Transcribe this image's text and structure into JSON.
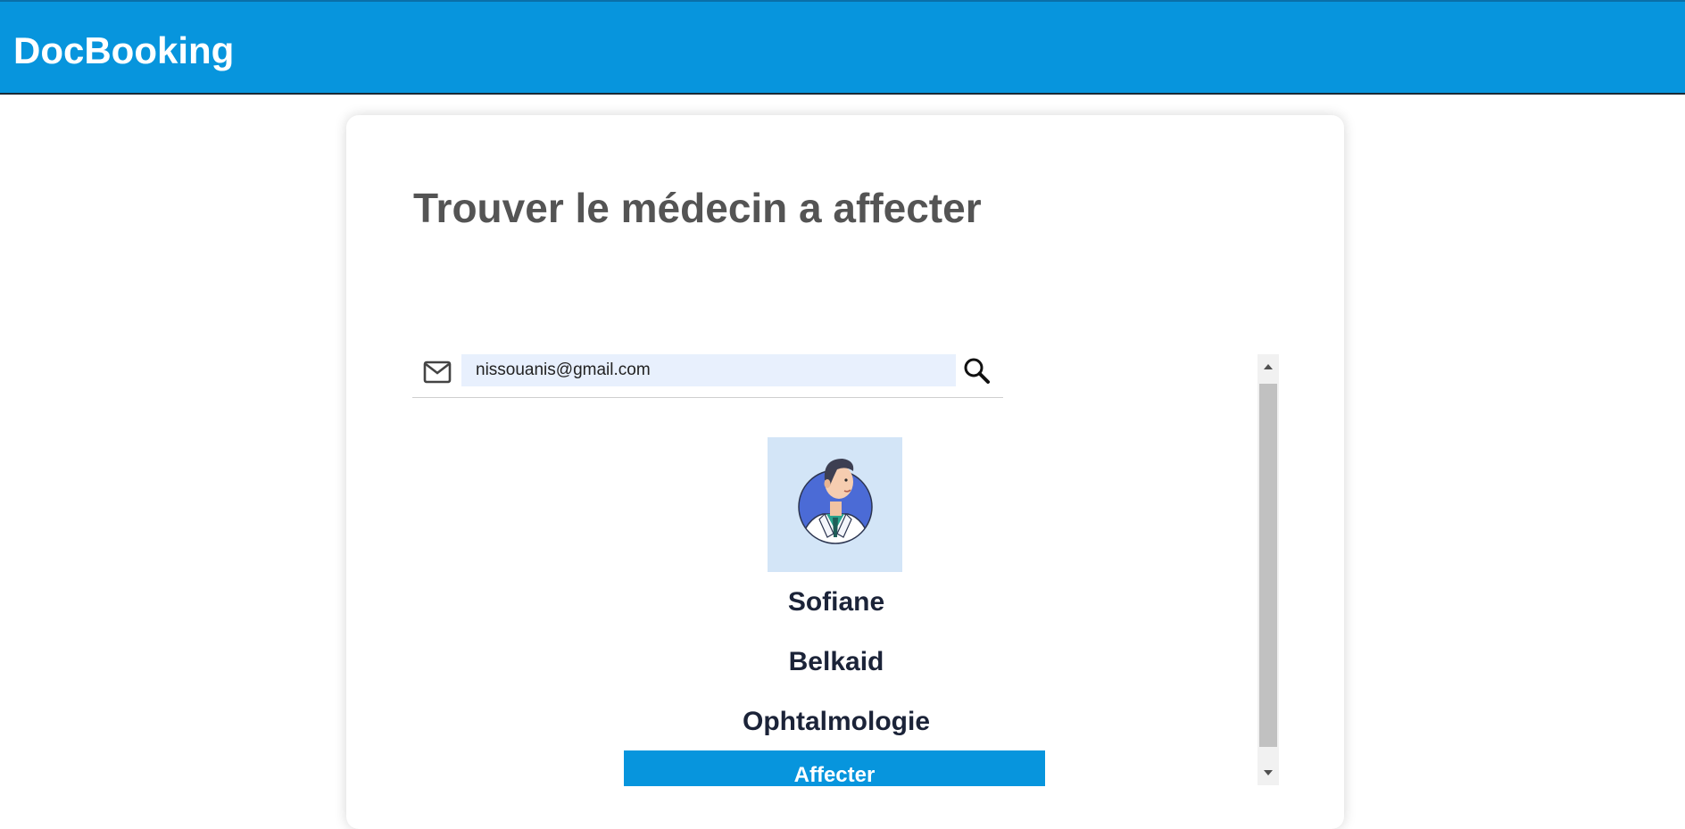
{
  "header": {
    "brand": "DocBooking",
    "color": "#0795dd"
  },
  "page": {
    "title": "Trouver le médecin a affecter"
  },
  "search": {
    "email_value": "nissouanis@gmail.com",
    "leading_icon": "mail-icon",
    "action_icon": "search-icon"
  },
  "doctor": {
    "avatar_icon": "doctor-avatar-icon",
    "first_name": "Sofiane",
    "last_name": "Belkaid",
    "specialty": "Ophtalmologie",
    "assign_label": "Affecter"
  },
  "colors": {
    "accent": "#0795dd",
    "title_text": "#545454",
    "doctor_text": "#1b2338",
    "input_bg": "#e8f0fd",
    "avatar_bg": "#d3e5f7"
  }
}
